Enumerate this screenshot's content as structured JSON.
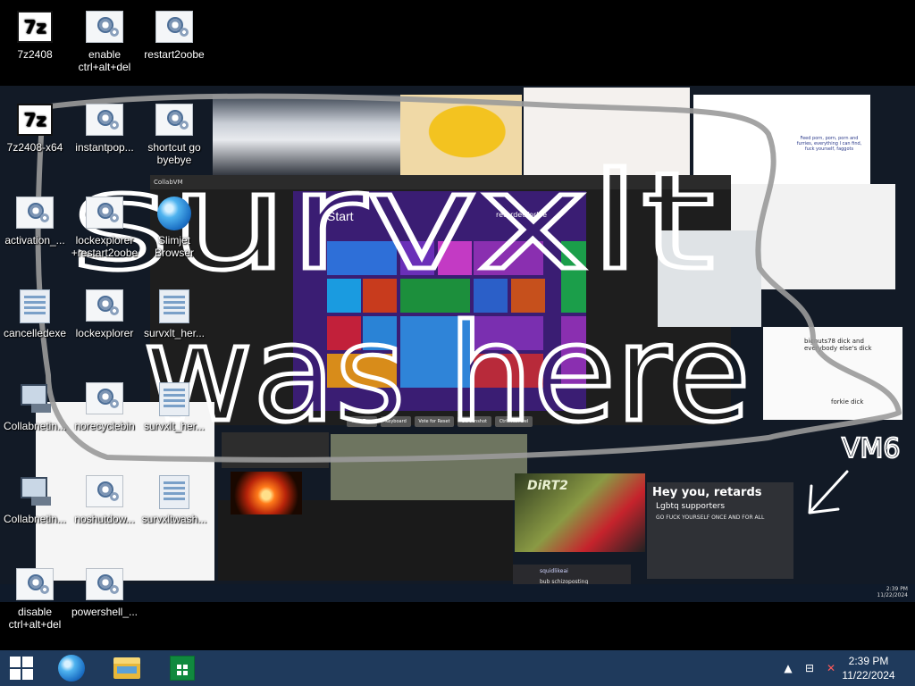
{
  "desktop": {
    "icons": [
      {
        "label": "7z2408",
        "kind": "sevenz"
      },
      {
        "label": "enable ctrl+alt+del",
        "kind": "gear"
      },
      {
        "label": "restart2oobe",
        "kind": "gear"
      },
      {
        "label": "7z2408-x64",
        "kind": "sevenz"
      },
      {
        "label": "instantpop...",
        "kind": "gear"
      },
      {
        "label": "shortcut go byebye",
        "kind": "gear"
      },
      {
        "label": "activation_...",
        "kind": "gear"
      },
      {
        "label": "lockexplorer +restart2oobe",
        "kind": "gear"
      },
      {
        "label": "Slimjet Browser",
        "kind": "globe"
      },
      {
        "label": "cancelledexe",
        "kind": "file"
      },
      {
        "label": "lockexplorer",
        "kind": "gear"
      },
      {
        "label": "survxlt_her...",
        "kind": "file"
      },
      {
        "label": "Collabnetin...",
        "kind": "network"
      },
      {
        "label": "norecyclebin",
        "kind": "gear"
      },
      {
        "label": "survxlt_her...",
        "kind": "file"
      },
      {
        "label": "Collabnetin...",
        "kind": "network"
      },
      {
        "label": "noshutdow...",
        "kind": "gear"
      },
      {
        "label": "survxltwash...",
        "kind": "file"
      },
      {
        "label": "disable ctrl+alt+del",
        "kind": "gear"
      },
      {
        "label": "powershell_...",
        "kind": "gear"
      }
    ]
  },
  "wallpaper": {
    "scribble_text": "survxlt was here",
    "vm_label": "VM6",
    "collab_brand": "CollabVM",
    "win8_start": "Start",
    "win8_user": "retardedforkie",
    "comic_text": "Feed porn, porn, porn and furries, everything I can find, fuck yourself, faggots",
    "drawing_text_1": "bignuts78 dick and everybody else's dick",
    "drawing_text_2": "forkie dick",
    "dirt_title": "DiRT2",
    "discord_title": "Hey you, retards",
    "discord_sub": "Lgbtq supporters",
    "discord_sub2": "GO FUCK YOURSELF ONCE AND FOR ALL",
    "msg_user": "squidlikeai",
    "msg_text": "bub schizoposting",
    "vm_buttons": [
      "Take Turn",
      "Keyboard",
      "Vote for Reset",
      "Screenshot",
      "Ctrl+Alt+Del"
    ],
    "inner_clock_time": "2:39 PM",
    "inner_clock_date": "11/22/2024"
  },
  "taskbar": {
    "start_label": "Start",
    "pinned": [
      "Internet Explorer",
      "File Explorer",
      "Store"
    ],
    "clock_time": "2:39 PM",
    "clock_date": "11/22/2024",
    "accent": "#1f3a5c"
  }
}
